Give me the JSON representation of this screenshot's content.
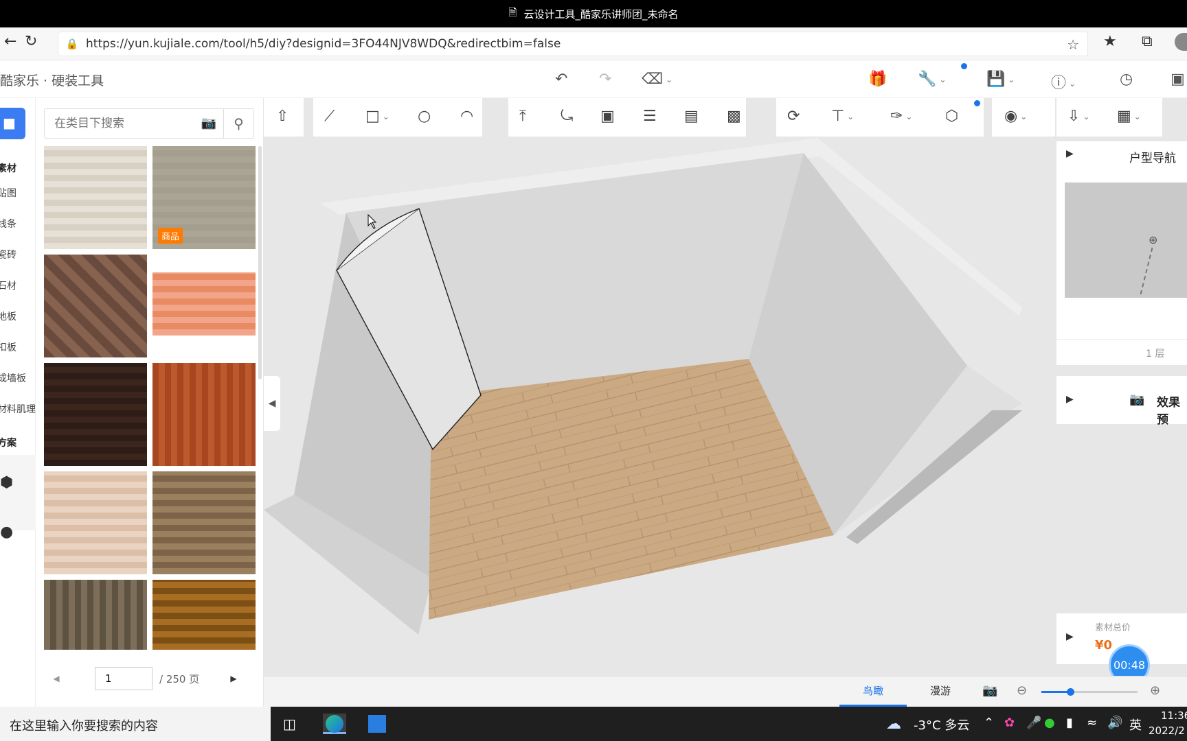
{
  "window": {
    "title": "云设计工具_酷家乐讲师团_未命名"
  },
  "browser": {
    "url": "https://yun.kujiale.com/tool/h5/diy?designid=3FO44NJV8WDQ&redirectbim=false"
  },
  "app": {
    "brand": "酷家乐 · 硬装工具"
  },
  "left_rail": {
    "items": [
      {
        "label": "素材",
        "header": true
      },
      {
        "label": "贴图"
      },
      {
        "label": "线条"
      },
      {
        "label": "瓷砖"
      },
      {
        "label": "石材"
      },
      {
        "label": "地板"
      },
      {
        "label": "扣板"
      },
      {
        "label": "成墙板"
      },
      {
        "label": "材料肌理"
      },
      {
        "label": "方案",
        "header": true
      }
    ]
  },
  "catalog": {
    "search_placeholder": "在类目下搜索",
    "tiles": [
      {
        "name": "light-oak",
        "colors": [
          "#e6e0d6",
          "#d7d0c3"
        ]
      },
      {
        "name": "greige-plain",
        "colors": [
          "#aaa594",
          "#a39e8d"
        ],
        "tag": "商品"
      },
      {
        "name": "herringbone",
        "colors": [
          "#6a4a3c",
          "#86624f"
        ]
      },
      {
        "name": "orange-wood",
        "colors": [
          "#f2a58a",
          "#e88a62"
        ]
      },
      {
        "name": "dark-walnut",
        "colors": [
          "#2e1c17",
          "#3b251d"
        ]
      },
      {
        "name": "red-cherry",
        "colors": [
          "#a8471f",
          "#bd5a2d"
        ]
      },
      {
        "name": "pale-planks",
        "colors": [
          "#ead3c0",
          "#dbbfa9"
        ]
      },
      {
        "name": "brown-oak",
        "colors": [
          "#9b8060",
          "#7d6448"
        ]
      },
      {
        "name": "bark-texture",
        "colors": [
          "#7c6e59",
          "#5e5241"
        ]
      },
      {
        "name": "cork",
        "colors": [
          "#a86d23",
          "#7c4f14"
        ]
      }
    ],
    "pager": {
      "page": "1",
      "total": "/ 250 页"
    }
  },
  "panels": {
    "floor_nav": {
      "title": "户型导航",
      "floor": "1 层"
    },
    "render": {
      "title": "效果预"
    },
    "total_price": {
      "label": "素材总价",
      "value": "¥0"
    }
  },
  "view_tabs": [
    {
      "label": "鸟瞰",
      "active": true
    },
    {
      "label": "漫游",
      "active": false
    }
  ],
  "timer": "00:48",
  "zoom": {
    "level": 0.3
  },
  "taskbar": {
    "search": "在这里输入你要搜索的内容",
    "weather": "-3°C  多云",
    "ime": "英",
    "time": "11:36",
    "date": "2022/2"
  },
  "colors": {
    "accent": "#1a73e8",
    "canvas": "#e7e7e8",
    "floor": "#c8a57c"
  }
}
